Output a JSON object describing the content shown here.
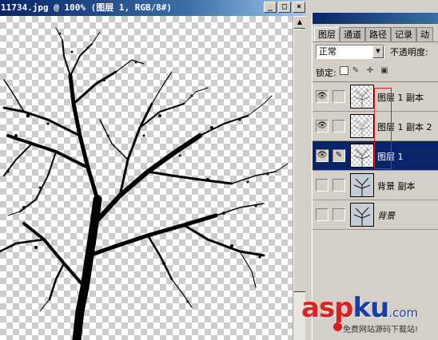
{
  "document": {
    "title": "11734.jpg @ 100% (图层 1, RGB/8#)",
    "controls": {
      "minimize": "_",
      "maximize": "□",
      "close": "×"
    }
  },
  "palette": {
    "tabs": [
      "图层",
      "通道",
      "路径",
      "记录",
      "动"
    ],
    "blend_mode": "正常",
    "opacity_label": "不透明度:",
    "lock_label": "锁定:",
    "layers": [
      {
        "name": "图层 1 副本",
        "visible": true,
        "selected": false,
        "italic": false
      },
      {
        "name": "图层 1 副本 2",
        "visible": true,
        "selected": false,
        "italic": false
      },
      {
        "name": "图层 1",
        "visible": true,
        "selected": true,
        "italic": false
      },
      {
        "name": "背景 副本",
        "visible": false,
        "selected": false,
        "italic": false
      },
      {
        "name": "背景",
        "visible": false,
        "selected": false,
        "italic": true
      }
    ]
  },
  "watermark": {
    "logo_red": "asp",
    "logo_blue": "ku",
    "logo_tld": ".com",
    "tagline": "免费网站源码下载站!"
  },
  "colors": {
    "title_bar": "#0a246a",
    "selected_layer": "#0a246a",
    "accent_red": "#d02020"
  }
}
